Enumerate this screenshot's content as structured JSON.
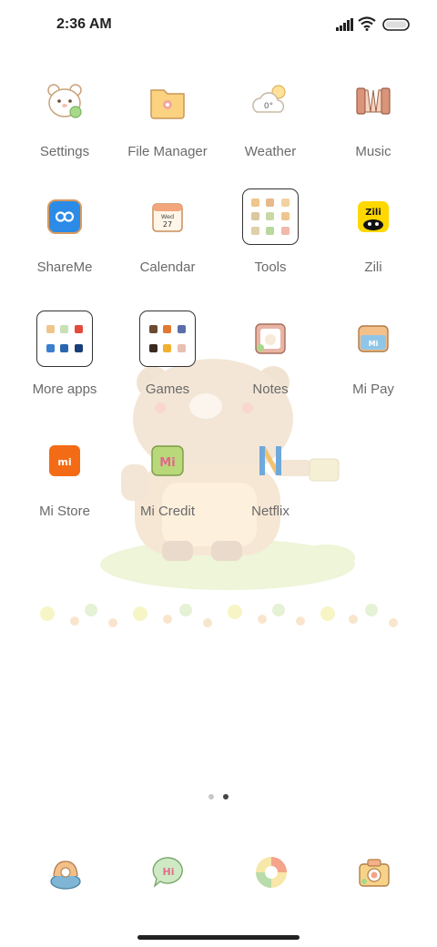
{
  "status_bar": {
    "time": "2:36 AM",
    "icons": [
      "signal-icon",
      "wifi-icon",
      "battery-icon"
    ]
  },
  "apps": [
    {
      "label": "Settings",
      "icon": "bear-gear-icon"
    },
    {
      "label": "File Manager",
      "icon": "folder-icon"
    },
    {
      "label": "Weather",
      "icon": "cloud-sun-icon",
      "icon_text": "0°"
    },
    {
      "label": "Music",
      "icon": "accordion-icon"
    },
    {
      "label": "ShareMe",
      "icon": "infinity-icon"
    },
    {
      "label": "Calendar",
      "icon": "calendar-icon",
      "icon_day": "Wed",
      "icon_date": "27"
    },
    {
      "label": "Tools",
      "icon": "folder-grid-icon"
    },
    {
      "label": "Zili",
      "icon": "zili-icon",
      "icon_text": "Zili"
    },
    {
      "label": "More apps",
      "icon": "folder-grid-icon"
    },
    {
      "label": "Games",
      "icon": "folder-grid-icon"
    },
    {
      "label": "Notes",
      "icon": "notes-bear-icon"
    },
    {
      "label": "Mi Pay",
      "icon": "wallet-icon",
      "icon_text": "Mi"
    },
    {
      "label": "Mi Store",
      "icon": "mi-store-icon",
      "icon_text": "mi"
    },
    {
      "label": "Mi Credit",
      "icon": "mi-credit-icon",
      "icon_text": "Mi"
    },
    {
      "label": "Netflix",
      "icon": "netflix-icon",
      "icon_text": "N"
    }
  ],
  "dock": [
    {
      "name": "phone",
      "icon": "phone-icon"
    },
    {
      "name": "messages",
      "icon": "message-bubble-icon",
      "icon_text": "Hi"
    },
    {
      "name": "browser",
      "icon": "browser-icon"
    },
    {
      "name": "camera",
      "icon": "camera-icon"
    }
  ],
  "page_indicator": {
    "pages": 2,
    "current": 2
  },
  "colors": {
    "label": "#6a6a6a",
    "wallpaper_bear": "#f3e2cc",
    "mi_orange": "#f46b16",
    "zili_yellow": "#ffd800",
    "shareme_blue": "#2c8be6"
  }
}
